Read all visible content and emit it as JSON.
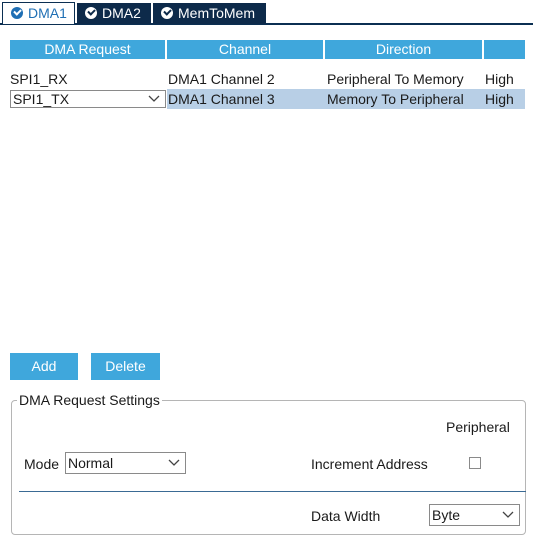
{
  "tabs": [
    {
      "label": "DMA1",
      "active": true
    },
    {
      "label": "DMA2",
      "active": false
    },
    {
      "label": "MemToMem",
      "active": false
    }
  ],
  "table": {
    "columns": [
      "DMA Request",
      "Channel",
      "Direction",
      ""
    ],
    "rows": [
      {
        "request": "SPI1_RX",
        "channel": "DMA1 Channel 2",
        "direction": "Peripheral To Memory",
        "priority": "High"
      },
      {
        "request": "SPI1_TX",
        "channel": "DMA1 Channel 3",
        "direction": "Memory To Peripheral",
        "priority": "High"
      }
    ]
  },
  "buttons": {
    "add": "Add",
    "delete": "Delete"
  },
  "settings": {
    "title": "DMA Request Settings",
    "peripheral_header": "Peripheral",
    "mode_label": "Mode",
    "mode_value": "Normal",
    "increment_label": "Increment Address",
    "increment_checked": false,
    "data_width_label": "Data Width",
    "data_width_value": "Byte"
  },
  "colors": {
    "accent": "#3fa7dc",
    "tab_dark": "#0d2a4a",
    "selection": "#b8cfe6"
  }
}
